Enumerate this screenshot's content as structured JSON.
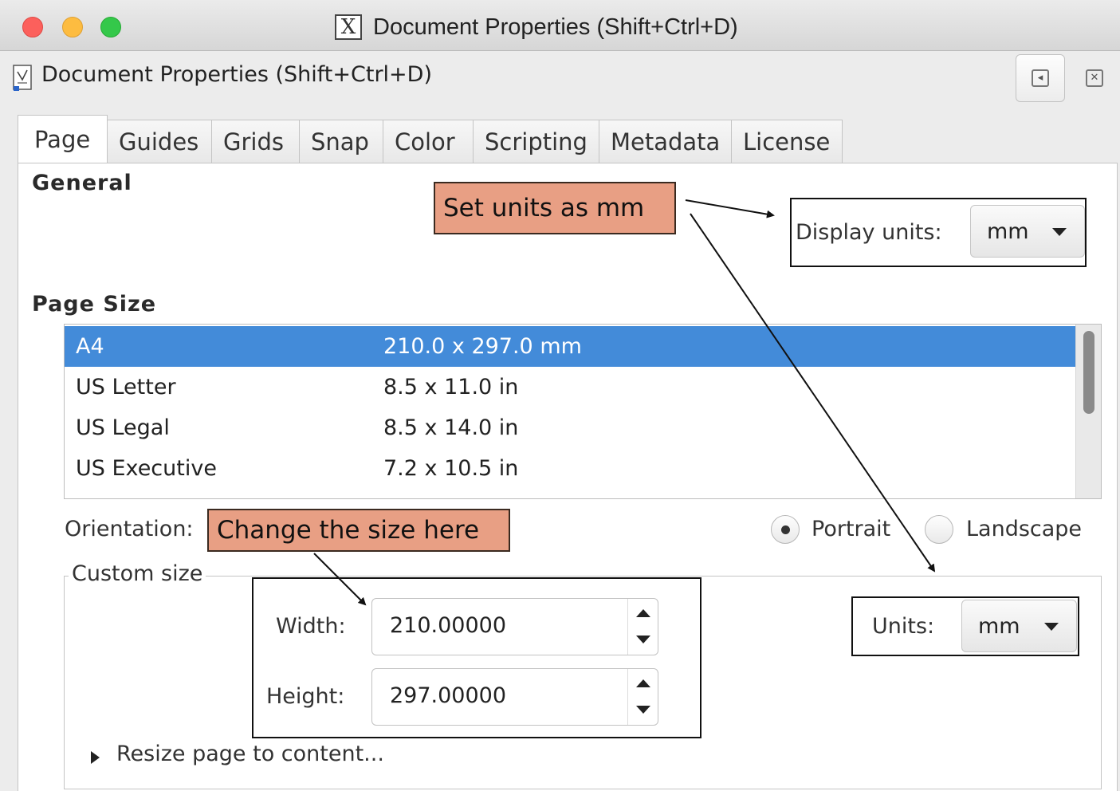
{
  "window": {
    "title": "Document Properties (Shift+Ctrl+D)",
    "app_icon": "x11-icon"
  },
  "dialog": {
    "title": "Document Properties (Shift+Ctrl+D)",
    "icon": "document-properties-icon"
  },
  "tabs": [
    {
      "label": "Page",
      "active": true
    },
    {
      "label": "Guides"
    },
    {
      "label": "Grids"
    },
    {
      "label": "Snap"
    },
    {
      "label": "Color"
    },
    {
      "label": "Scripting"
    },
    {
      "label": "Metadata"
    },
    {
      "label": "License"
    }
  ],
  "general": {
    "heading": "General",
    "display_units_label": "Display units:",
    "display_units_value": "mm"
  },
  "page_size": {
    "heading": "Page Size",
    "rows": [
      {
        "name": "A4",
        "size": "210.0 x 297.0 mm",
        "selected": true
      },
      {
        "name": "US Letter",
        "size": "8.5 x 11.0 in"
      },
      {
        "name": "US Legal",
        "size": "8.5 x 14.0 in"
      },
      {
        "name": "US Executive",
        "size": "7.2 x 10.5 in"
      }
    ]
  },
  "orientation": {
    "label": "Orientation:",
    "portrait": "Portrait",
    "landscape": "Landscape",
    "selected": "Portrait"
  },
  "custom_size": {
    "legend": "Custom size",
    "width_label": "Width:",
    "width_value": "210.00000",
    "height_label": "Height:",
    "height_value": "297.00000",
    "units_label": "Units:",
    "units_value": "mm",
    "resize_label": "Resize page to content..."
  },
  "annotations": {
    "units_callout": "Set units as mm",
    "size_callout": "Change the size here",
    "callout_color": "#e89f84"
  },
  "colors": {
    "selection": "#438bd9"
  }
}
